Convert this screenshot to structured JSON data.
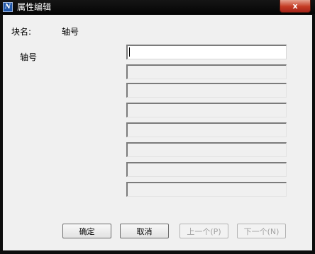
{
  "window": {
    "title": "属性编辑",
    "close_label": "x"
  },
  "dialog": {
    "block_label": "块名:",
    "block_value": "轴号",
    "attribute_label": "轴号",
    "fields": [
      "",
      "",
      "",
      "",
      "",
      "",
      "",
      ""
    ]
  },
  "buttons": {
    "ok": "确定",
    "cancel": "取消",
    "prev": "上一个(P)",
    "next": "下一个(N)"
  }
}
